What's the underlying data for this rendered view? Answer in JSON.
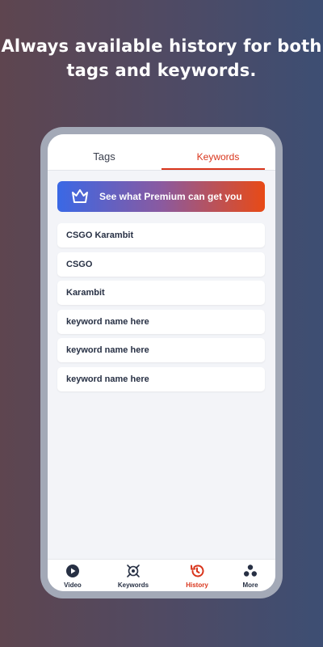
{
  "headline": {
    "line1": "Always available history for both",
    "line2": "tags and keywords."
  },
  "tabs": [
    {
      "label": "Tags",
      "active": false
    },
    {
      "label": "Keywords",
      "active": true
    }
  ],
  "premium_banner": {
    "label": "See what Premium can get you",
    "icon": "crown-icon"
  },
  "history_items": [
    "CSGO Karambit",
    "CSGO",
    "Karambit",
    "keyword name here",
    "keyword name here",
    "keyword name here"
  ],
  "bottom_nav": [
    {
      "label": "Video",
      "icon": "play-icon",
      "active": false
    },
    {
      "label": "Keywords",
      "icon": "target-icon",
      "active": false
    },
    {
      "label": "History",
      "icon": "history-icon",
      "active": true
    },
    {
      "label": "More",
      "icon": "more-dots-icon",
      "active": false
    }
  ],
  "colors": {
    "accent": "#d9351c",
    "text_dark": "#273044",
    "premium_gradient_start": "#3a68e5",
    "premium_gradient_end": "#e84a16"
  }
}
